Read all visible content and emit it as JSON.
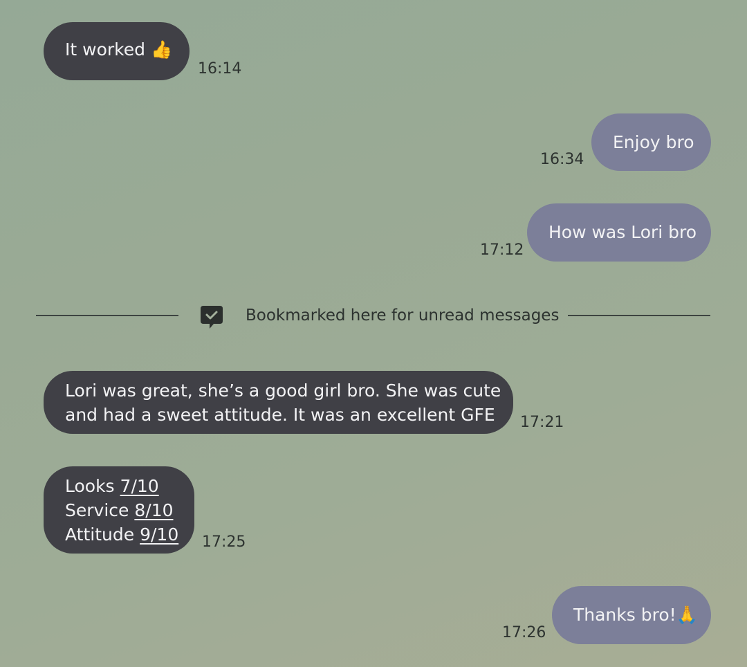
{
  "messages": [
    {
      "direction": "incoming",
      "text": "It worked",
      "emoji": "👍",
      "time": "16:14"
    },
    {
      "direction": "outgoing",
      "text": "Enjoy bro",
      "time": "16:34"
    },
    {
      "direction": "outgoing",
      "text": "How was Lori bro",
      "time": "17:12"
    },
    {
      "direction": "incoming",
      "line1": "Lori was great, she’s a good girl bro. She was cute",
      "line2": "and had a sweet attitude. It was an excellent GFE",
      "time": "17:21"
    },
    {
      "direction": "incoming",
      "ratings": [
        {
          "label": "Looks",
          "score": "7/10"
        },
        {
          "label": "Service",
          "score": "8/10"
        },
        {
          "label": "Attitude",
          "score": "9/10"
        }
      ],
      "time": "17:25"
    },
    {
      "direction": "outgoing",
      "text": "Thanks bro!",
      "emoji": "🙏",
      "time": "17:26"
    }
  ],
  "unread_divider": {
    "text": "Bookmarked here for unread messages",
    "icon": "bookmark-chat-icon"
  },
  "colors": {
    "incoming_bubble": "#404046",
    "outgoing_bubble": "#7c7f99",
    "background": "#9aaa95"
  }
}
